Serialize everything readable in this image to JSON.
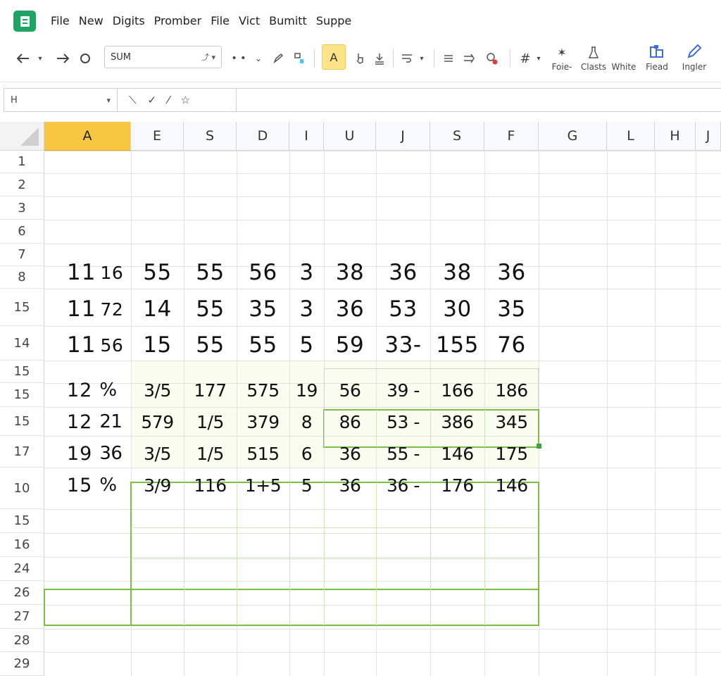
{
  "menu": {
    "items": [
      "File",
      "New",
      "Digits",
      "Promber",
      "File",
      "Vict",
      "Bumitt",
      "Suppe"
    ]
  },
  "toolbar": {
    "font_name": "SUM",
    "font_a_label": "A",
    "right_buttons": [
      {
        "icon": "star-icon",
        "label": "Foie-"
      },
      {
        "icon": "flask-icon",
        "label": "Clasts"
      },
      {
        "icon": "white-icon",
        "label": "White"
      },
      {
        "icon": "field-icon",
        "label": "Fiead"
      },
      {
        "icon": "pen-icon",
        "label": "Ingler"
      }
    ]
  },
  "formula_bar": {
    "name_box": "H",
    "formula": ""
  },
  "grid": {
    "columns": [
      "A",
      "E",
      "S",
      "D",
      "I",
      "U",
      "J",
      "S",
      "F",
      "G",
      "L",
      "H",
      "J"
    ],
    "active_column": "A",
    "row_numbers": [
      "1",
      "2",
      "3",
      "6",
      "7",
      "8",
      "15",
      "14",
      "15",
      "15",
      "15",
      "17",
      "10",
      "15",
      "16",
      "24",
      "26",
      "27",
      "28",
      "29"
    ],
    "data_rows": [
      {
        "a_main": "11",
        "a_sub": "16",
        "cells": [
          "55",
          "55",
          "56",
          "3",
          "38",
          "36",
          "38",
          "36"
        ]
      },
      {
        "a_main": "11",
        "a_sub": "72",
        "cells": [
          "14",
          "55",
          "35",
          "3",
          "36",
          "53",
          "30",
          "35"
        ]
      },
      {
        "a_main": "11",
        "a_sub": "56",
        "cells": [
          "15",
          "55",
          "55",
          "5",
          "59",
          "33-",
          "155",
          "76"
        ]
      },
      {
        "a_main": "12",
        "a_sub": "%",
        "cells": [
          "3/5",
          "177",
          "575",
          "19",
          "56",
          "39 -",
          "166",
          "186"
        ]
      },
      {
        "a_main": "12",
        "a_sub": "21",
        "cells": [
          "579",
          "1/5",
          "379",
          "8",
          "86",
          "53 -",
          "386",
          "345"
        ]
      },
      {
        "a_main": "19",
        "a_sub": "36",
        "cells": [
          "3/5",
          "1/5",
          "515",
          "6",
          "36",
          "55 -",
          "146",
          "175"
        ]
      },
      {
        "a_main": "15",
        "a_sub": "%",
        "cells": [
          "3/9",
          "116",
          "1+5",
          "5",
          "36",
          "36 -",
          "176",
          "146"
        ]
      }
    ]
  },
  "colors": {
    "accent_green": "#1fa463",
    "active_column": "#f7c742",
    "selection_border": "#7bc043"
  }
}
